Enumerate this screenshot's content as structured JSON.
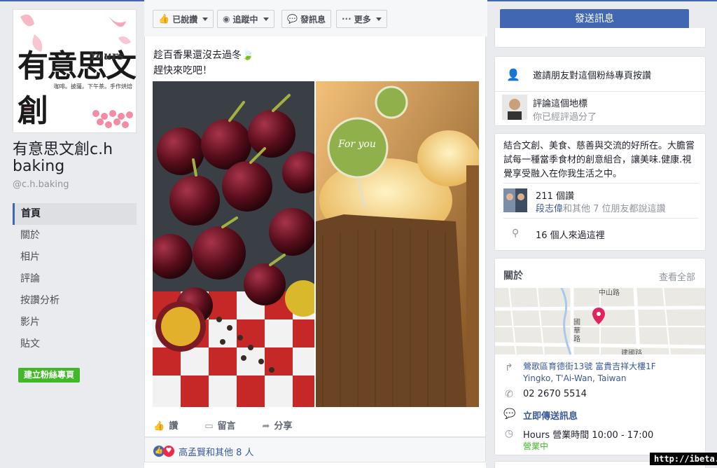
{
  "page": {
    "logo_main": "有意思文創",
    "logo_yours": "Yours",
    "logo_tagline": "咖啡。披薩。下午茶。手作烘焙",
    "name": "有意思文創c.h baking",
    "handle": "@c.h.baking"
  },
  "nav": {
    "items": [
      {
        "label": "首頁",
        "active": true
      },
      {
        "label": "關於"
      },
      {
        "label": "相片"
      },
      {
        "label": "評論"
      },
      {
        "label": "按讚分析"
      },
      {
        "label": "影片"
      },
      {
        "label": "貼文"
      }
    ],
    "create_page": "建立粉絲專頁"
  },
  "actions": {
    "liked": "已說讚",
    "following": "追蹤中",
    "message": "發訊息",
    "more": "更多",
    "send_message": "發送訊息"
  },
  "post": {
    "text_line1": "趁百香果還沒去過冬🍃",
    "text_line2": "趕快來吃吧！",
    "photo_label": "For you",
    "like_label": "讚",
    "comment_label": "留言",
    "share_label": "分享",
    "reactions_text": "高孟賢和其他 8 人"
  },
  "right": {
    "invite_text": "邀請朋友對這個粉絲專頁按讚",
    "review_title": "評論這個地標",
    "review_sub": "你已經評過分了",
    "description": "結合文創、美食、慈善與交流的好所在。大膽嘗試每一種當季食材的創意組合，讓美味.健康.視覺享受融入在你我生活之中。",
    "likes_count": "211 個讚",
    "friends_name": "段志偉",
    "friends_rest": "和其他 7 位朋友都說這讚",
    "checkins": "16 個人來過這裡",
    "about_title": "關於",
    "see_all": "查看全部",
    "map_label1": "中山路",
    "map_label2": "國華路",
    "map_label3": "建國路",
    "address1": "鶯歌區育德街13號 富貴吉祥大樓1F",
    "address2": "Yingko, T'Ai-Wan, Taiwan",
    "phone": "02 2670 5514",
    "send_now": "立即傳送訊息",
    "hours": "Hours 營業時間 10:00 - 17:00",
    "open_now": "營業中"
  },
  "watermark": "http://ibeta.tw",
  "colors": {
    "brand": "#4267b2",
    "link": "#385898",
    "green": "#42b72a"
  }
}
